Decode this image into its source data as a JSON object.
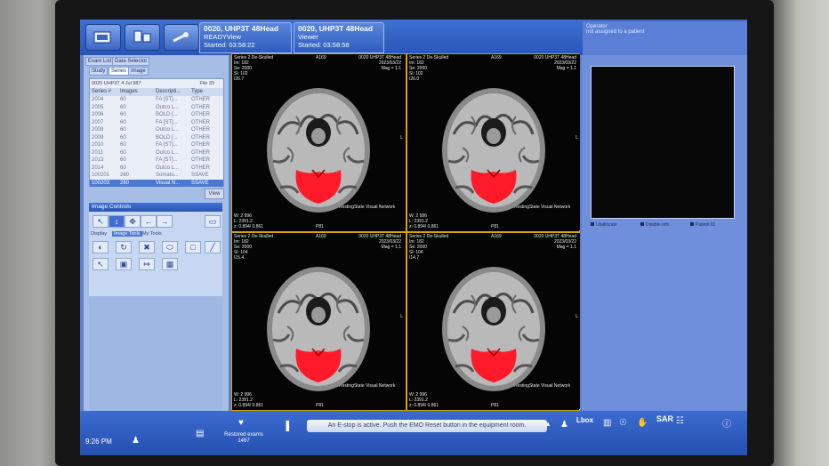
{
  "toolbar": {
    "exam_tab_1": {
      "title": "0020, UHP3T 48Head",
      "line2": "READYView",
      "line3": "Started: 03:58:22"
    },
    "exam_tab_2": {
      "title": "0020, UHP3T 48Head",
      "line2": "Viewer",
      "line3": "Started: 03:58:58"
    }
  },
  "right_panel": {
    "user_label": "Operator",
    "user_sub": "not assigned to a patient",
    "checks": [
      "Unallocate",
      "Disable Info",
      "Patient ID"
    ]
  },
  "left_panel": {
    "tabs_top": [
      "Exam List",
      "Data Selector"
    ],
    "tabs_sub": [
      "Study",
      "Series",
      "Image"
    ],
    "exam_id": "0020 UHP3T 4 Jul 987",
    "file_id": "File 33",
    "series_headers": [
      "Series #",
      "Images",
      "Descripti...",
      "Type"
    ],
    "series_rows": [
      [
        "2004",
        "60",
        "FA [ST]...",
        "OTHER"
      ],
      [
        "2005",
        "60",
        "Outco L...",
        "OTHER"
      ],
      [
        "2006",
        "60",
        "BOLD [...",
        "OTHER"
      ],
      [
        "2007",
        "60",
        "FA [ST]...",
        "OTHER"
      ],
      [
        "2008",
        "60",
        "Outco L...",
        "OTHER"
      ],
      [
        "2009",
        "60",
        "BOLD [...",
        "OTHER"
      ],
      [
        "2010",
        "60",
        "FA [ST]...",
        "OTHER"
      ],
      [
        "2011",
        "60",
        "Outco L...",
        "OTHER"
      ],
      [
        "2013",
        "60",
        "FA [ST]...",
        "OTHER"
      ],
      [
        "2014",
        "60",
        "Outco L...",
        "OTHER"
      ],
      [
        "100201",
        "260",
        "Somato...",
        "SSAVE"
      ],
      [
        "100203",
        "260",
        "Visual N...",
        "SSAVE"
      ]
    ],
    "view_button": "View",
    "image_controls_title": "Image Controls",
    "ic_subtabs": [
      "Display",
      "Image Tools",
      "My Tools"
    ]
  },
  "viewports": [
    {
      "series": "Series 2 De-Skulled",
      "im": "Im: 182",
      "se": "Se: 2000",
      "sl": "Sl: 102",
      "z": "I26.7",
      "center_top": "A169",
      "exam": "0020 UHP3T 48Head",
      "date": "2023/03/22",
      "mag": "Mag = 1.1",
      "network": "RestingState Visual Network",
      "bottom_center": "P81",
      "wl": "W: 2 996",
      "ww": "L: 2391.2",
      "thresh": "z: 0.894/ 0.861",
      "side": "L"
    },
    {
      "series": "Series 2 De-Skulled",
      "im": "Im: 182",
      "se": "Se: 2000",
      "sl": "Sl: 102",
      "z": "I26.0",
      "center_top": "A169",
      "exam": "0020 UHP3T 48Head",
      "date": "2023/03/22",
      "mag": "Mag = 1.1",
      "network": "RestingState Visual Network",
      "bottom_center": "P81",
      "wl": "W: 2 996",
      "ww": "L: 2391.2",
      "thresh": "z: 0.894/ 0.861",
      "side": "L"
    },
    {
      "series": "Series 2 De-Skulled",
      "im": "Im: 182",
      "se": "Se: 2000",
      "sl": "Sl: 104",
      "z": "I15.4",
      "center_top": "A169",
      "exam": "0020 UHP3T 48Head",
      "date": "2023/03/22",
      "mag": "Mag = 1.1",
      "network": "RestingState Visual Network",
      "bottom_center": "P81",
      "wl": "W: 2 996",
      "ww": "L: 2391.2",
      "thresh": "z: 0.894/ 0.861",
      "side": "L"
    },
    {
      "series": "Series 2 De-Skulled",
      "im": "Im: 182",
      "se": "Se: 2000",
      "sl": "Sl: 104",
      "z": "I14.7",
      "center_top": "A169",
      "exam": "0020 UHP3T 48Head",
      "date": "2023/03/22",
      "mag": "Mag = 1.1",
      "network": "RestingState Visual Network",
      "bottom_center": "P81",
      "wl": "W: 2 996",
      "ww": "L: 2391.2",
      "thresh": "z: 0.894/ 0.861",
      "side": "L"
    }
  ],
  "status": {
    "clock": "9:26 PM",
    "message": "An E-stop is active. Push the EMO Reset button in the equipment room.",
    "restored_label": "Restored exams",
    "restored_count": "1467",
    "lbox_label": "Lbox",
    "sar_label": "SAR"
  },
  "colors": {
    "accent": "#3e6fd2",
    "activation": "#ff1a2a",
    "viewport_border": "#d6a400"
  },
  "icons": [
    "screen-capture-icon",
    "network-device-icon",
    "scanner-table-icon",
    "close-icon",
    "pointer-icon",
    "zoom-icon",
    "pan-icon",
    "rotate-icon",
    "flip-icon",
    "window-level-icon",
    "document-icon",
    "person-icon",
    "measure-icon",
    "help-icon"
  ]
}
